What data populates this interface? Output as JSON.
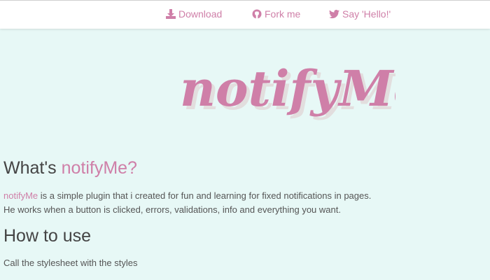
{
  "nav": {
    "download": {
      "label": "Download",
      "icon": "download-icon"
    },
    "fork": {
      "label": "Fork me",
      "icon": "github-icon"
    },
    "tweet": {
      "label": "Say 'Hello!'",
      "icon": "twitter-icon"
    }
  },
  "logo": {
    "text": "notifyMe"
  },
  "section_what": {
    "prefix": "What's ",
    "accent": "notifyMe?",
    "intro_accent": "notifyMe",
    "intro_rest": " is a simple plugin that i created for fun and learning for fixed notifications in pages.",
    "intro_line2": "He works when a button is clicked, errors, validations, info and everything you want."
  },
  "section_how": {
    "title": "How to use",
    "text": "Call the stylesheet with the styles"
  },
  "colors": {
    "accent": "#cf7fa8",
    "background": "#e7f8f6",
    "heading": "#444444",
    "text": "#555555"
  }
}
